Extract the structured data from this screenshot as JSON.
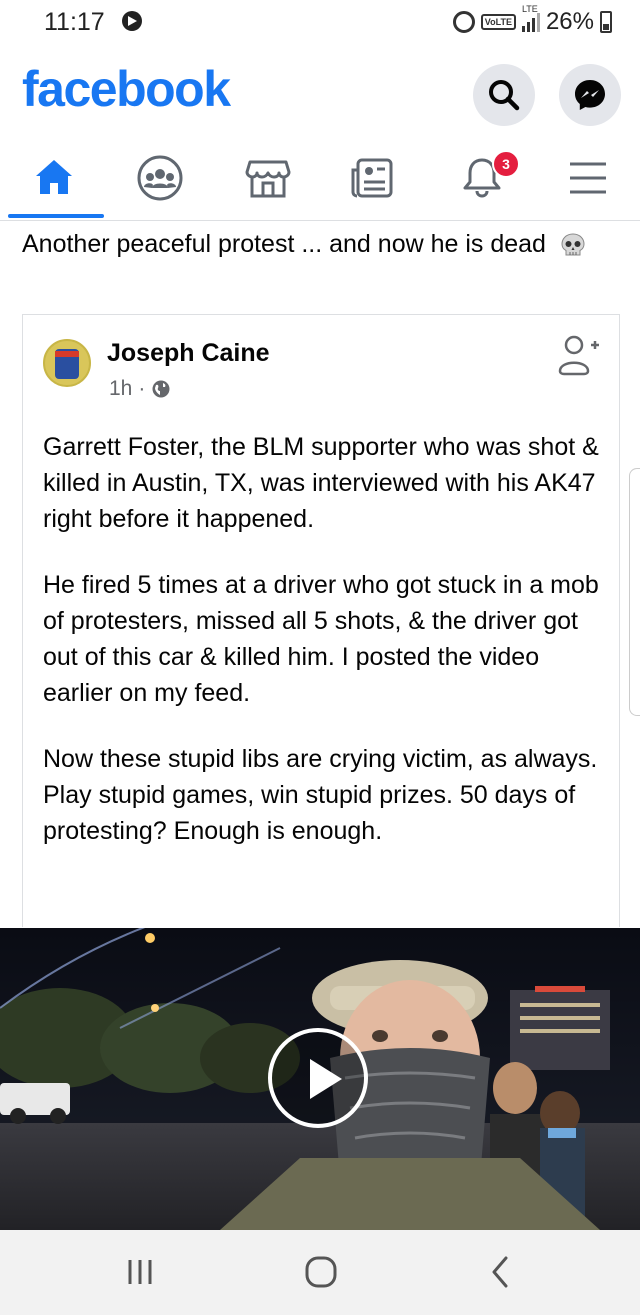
{
  "status_bar": {
    "time": "11:17",
    "network": "LTE",
    "volte": "VoLTE",
    "battery": "26%"
  },
  "header": {
    "logo": "facebook",
    "search_icon": "search-icon",
    "messenger_icon": "messenger-icon"
  },
  "nav": {
    "tabs": [
      {
        "name": "home",
        "icon": "home-icon",
        "active": true
      },
      {
        "name": "groups",
        "icon": "groups-icon",
        "active": false
      },
      {
        "name": "marketplace",
        "icon": "marketplace-icon",
        "active": false
      },
      {
        "name": "news",
        "icon": "news-icon",
        "active": false
      },
      {
        "name": "notifications",
        "icon": "bell-icon",
        "active": false,
        "badge": "3"
      },
      {
        "name": "menu",
        "icon": "menu-icon",
        "active": false
      }
    ]
  },
  "post": {
    "caption": "Another peaceful protest  ... and now he is dead"
  },
  "shared_post": {
    "author": "Joseph Caine",
    "time": "1h",
    "separator": "·",
    "paragraphs": [
      "Garrett Foster, the BLM supporter who was shot & killed in Austin, TX, was interviewed with his AK47 right before it happened.",
      "He fired 5 times at a driver who got stuck in a mob of protesters, missed all 5 shots, & the driver got out of this car & killed him. I posted the video earlier on my feed.",
      "Now these stupid libs are crying victim, as always. Play stupid games, win stupid prizes. 50 days of protesting? Enough is enough."
    ]
  },
  "colors": {
    "brand": "#1877f2",
    "badge": "#e41e3f",
    "text": "#050505",
    "secondary_text": "#65676b"
  }
}
